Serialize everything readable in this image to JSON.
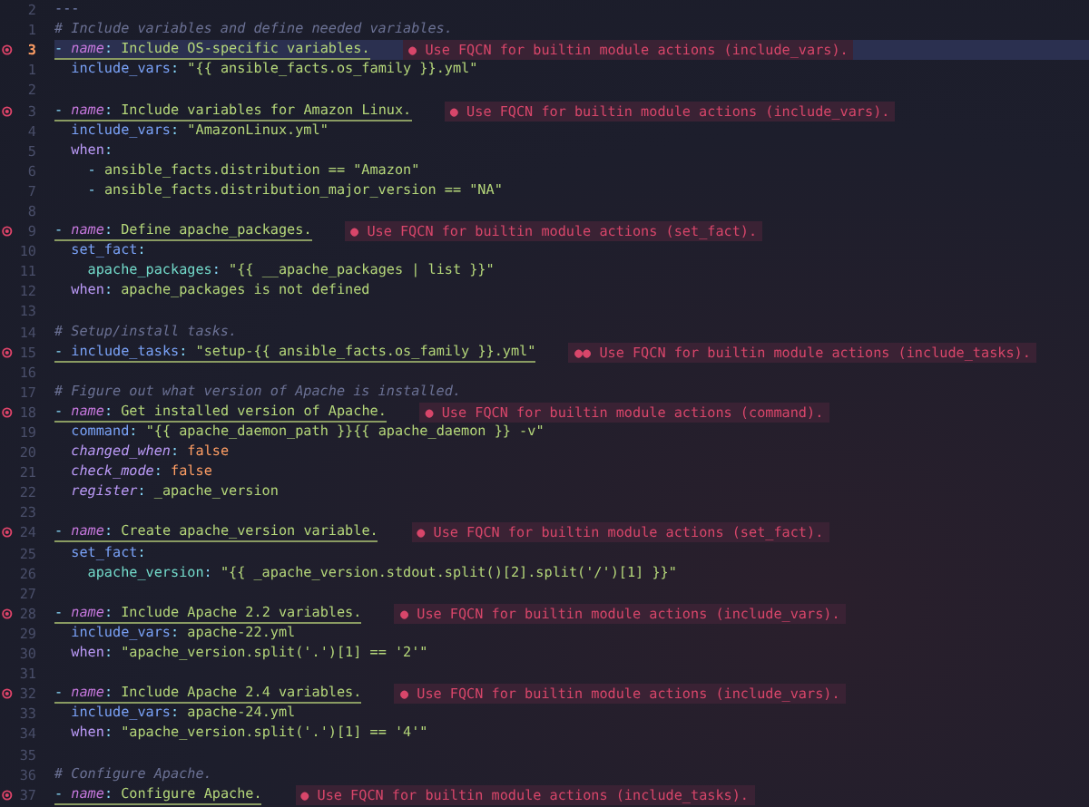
{
  "editor": {
    "lines": [
      {
        "number": "2",
        "error": false,
        "current": false,
        "segments": [
          {
            "kind": "marker",
            "text": "---"
          }
        ]
      },
      {
        "number": "1",
        "error": false,
        "current": false,
        "segments": [
          {
            "kind": "comment",
            "text": "# Include variables and define needed variables."
          }
        ]
      },
      {
        "number": "3",
        "error": true,
        "current": true,
        "segments": [
          {
            "kind": "dash",
            "text": "- "
          },
          {
            "kind": "name",
            "text": "name"
          },
          {
            "kind": "punct",
            "text": ": "
          },
          {
            "kind": "string",
            "text": "Include OS-specific variables."
          }
        ],
        "diagnostic": "● Use FQCN for builtin module actions (include_vars)."
      },
      {
        "number": "1",
        "error": false,
        "current": false,
        "segments": [
          {
            "kind": "key",
            "text": "  include_vars"
          },
          {
            "kind": "punct",
            "text": ": "
          },
          {
            "kind": "string",
            "text": "\"{{ ansible_facts.os_family }}.yml\""
          }
        ]
      },
      {
        "number": "2",
        "error": false,
        "current": false
      },
      {
        "number": "3",
        "error": true,
        "current": false,
        "segments": [
          {
            "kind": "dash",
            "text": "- "
          },
          {
            "kind": "name",
            "text": "name"
          },
          {
            "kind": "punct",
            "text": ": "
          },
          {
            "kind": "string",
            "text": "Include variables for Amazon Linux."
          }
        ],
        "diagnostic": "● Use FQCN for builtin module actions (include_vars)."
      },
      {
        "number": "4",
        "error": false,
        "current": false,
        "segments": [
          {
            "kind": "key",
            "text": "  include_vars"
          },
          {
            "kind": "punct",
            "text": ": "
          },
          {
            "kind": "string",
            "text": "\"AmazonLinux.yml\""
          }
        ]
      },
      {
        "number": "5",
        "error": false,
        "current": false,
        "segments": [
          {
            "kind": "keyword",
            "text": "  when"
          },
          {
            "kind": "punct",
            "text": ":"
          }
        ]
      },
      {
        "number": "6",
        "error": false,
        "current": false,
        "segments": [
          {
            "kind": "punct",
            "text": "    - "
          },
          {
            "kind": "string",
            "text": "ansible_facts.distribution == \"Amazon\""
          }
        ]
      },
      {
        "number": "7",
        "error": false,
        "current": false,
        "segments": [
          {
            "kind": "punct",
            "text": "    - "
          },
          {
            "kind": "string",
            "text": "ansible_facts.distribution_major_version == \"NA\""
          }
        ]
      },
      {
        "number": "8",
        "error": false,
        "current": false
      },
      {
        "number": "9",
        "error": true,
        "current": false,
        "segments": [
          {
            "kind": "dash",
            "text": "- "
          },
          {
            "kind": "name",
            "text": "name"
          },
          {
            "kind": "punct",
            "text": ": "
          },
          {
            "kind": "string",
            "text": "Define apache_packages."
          }
        ],
        "diagnostic": "● Use FQCN for builtin module actions (set_fact)."
      },
      {
        "number": "10",
        "error": false,
        "current": false,
        "segments": [
          {
            "kind": "key",
            "text": "  set_fact"
          },
          {
            "kind": "punct",
            "text": ":"
          }
        ]
      },
      {
        "number": "11",
        "error": false,
        "current": false,
        "segments": [
          {
            "kind": "subkey",
            "text": "    apache_packages"
          },
          {
            "kind": "punct",
            "text": ": "
          },
          {
            "kind": "string",
            "text": "\"{{ __apache_packages | list }}\""
          }
        ]
      },
      {
        "number": "12",
        "error": false,
        "current": false,
        "segments": [
          {
            "kind": "keyword",
            "text": "  when"
          },
          {
            "kind": "punct",
            "text": ": "
          },
          {
            "kind": "string",
            "text": "apache_packages is not defined"
          }
        ]
      },
      {
        "number": "13",
        "error": false,
        "current": false
      },
      {
        "number": "14",
        "error": false,
        "current": false,
        "segments": [
          {
            "kind": "comment",
            "text": "# Setup/install tasks."
          }
        ]
      },
      {
        "number": "15",
        "error": true,
        "current": false,
        "segments": [
          {
            "kind": "dash",
            "text": "- "
          },
          {
            "kind": "key",
            "text": "include_tasks"
          },
          {
            "kind": "punct",
            "text": ": "
          },
          {
            "kind": "string",
            "text": "\"setup-{{ ansible_facts.os_family }}.yml\""
          }
        ],
        "diagnostic": "●● Use FQCN for builtin module actions (include_tasks)."
      },
      {
        "number": "16",
        "error": false,
        "current": false
      },
      {
        "number": "17",
        "error": false,
        "current": false,
        "segments": [
          {
            "kind": "comment",
            "text": "# Figure out what version of Apache is installed."
          }
        ]
      },
      {
        "number": "18",
        "error": true,
        "current": false,
        "segments": [
          {
            "kind": "dash",
            "text": "- "
          },
          {
            "kind": "name",
            "text": "name"
          },
          {
            "kind": "punct",
            "text": ": "
          },
          {
            "kind": "string",
            "text": "Get installed version of Apache."
          }
        ],
        "diagnostic": "● Use FQCN for builtin module actions (command)."
      },
      {
        "number": "19",
        "error": false,
        "current": false,
        "segments": [
          {
            "kind": "key",
            "text": "  command"
          },
          {
            "kind": "punct",
            "text": ": "
          },
          {
            "kind": "string",
            "text": "\"{{ apache_daemon_path }}{{ apache_daemon }} -v\""
          }
        ]
      },
      {
        "number": "20",
        "error": false,
        "current": false,
        "segments": [
          {
            "kind": "italic",
            "text": "  changed_when"
          },
          {
            "kind": "punct",
            "text": ": "
          },
          {
            "kind": "bool",
            "text": "false"
          }
        ]
      },
      {
        "number": "21",
        "error": false,
        "current": false,
        "segments": [
          {
            "kind": "italic",
            "text": "  check_mode"
          },
          {
            "kind": "punct",
            "text": ": "
          },
          {
            "kind": "bool",
            "text": "false"
          }
        ]
      },
      {
        "number": "22",
        "error": false,
        "current": false,
        "segments": [
          {
            "kind": "italic",
            "text": "  register"
          },
          {
            "kind": "punct",
            "text": ": "
          },
          {
            "kind": "string",
            "text": "_apache_version"
          }
        ]
      },
      {
        "number": "23",
        "error": false,
        "current": false
      },
      {
        "number": "24",
        "error": true,
        "current": false,
        "segments": [
          {
            "kind": "dash",
            "text": "- "
          },
          {
            "kind": "name",
            "text": "name"
          },
          {
            "kind": "punct",
            "text": ": "
          },
          {
            "kind": "string",
            "text": "Create apache_version variable."
          }
        ],
        "diagnostic": "● Use FQCN for builtin module actions (set_fact)."
      },
      {
        "number": "25",
        "error": false,
        "current": false,
        "segments": [
          {
            "kind": "key",
            "text": "  set_fact"
          },
          {
            "kind": "punct",
            "text": ":"
          }
        ]
      },
      {
        "number": "26",
        "error": false,
        "current": false,
        "segments": [
          {
            "kind": "subkey",
            "text": "    apache_version"
          },
          {
            "kind": "punct",
            "text": ": "
          },
          {
            "kind": "string",
            "text": "\"{{ _apache_version.stdout.split()[2].split('/')[1] }}\""
          }
        ]
      },
      {
        "number": "27",
        "error": false,
        "current": false
      },
      {
        "number": "28",
        "error": true,
        "current": false,
        "segments": [
          {
            "kind": "dash",
            "text": "- "
          },
          {
            "kind": "name",
            "text": "name"
          },
          {
            "kind": "punct",
            "text": ": "
          },
          {
            "kind": "string",
            "text": "Include Apache 2.2 variables."
          }
        ],
        "diagnostic": "● Use FQCN for builtin module actions (include_vars)."
      },
      {
        "number": "29",
        "error": false,
        "current": false,
        "segments": [
          {
            "kind": "key",
            "text": "  include_vars"
          },
          {
            "kind": "punct",
            "text": ": "
          },
          {
            "kind": "string",
            "text": "apache-22.yml"
          }
        ]
      },
      {
        "number": "30",
        "error": false,
        "current": false,
        "segments": [
          {
            "kind": "keyword",
            "text": "  when"
          },
          {
            "kind": "punct",
            "text": ": "
          },
          {
            "kind": "string",
            "text": "\"apache_version.split('.')[1] == '2'\""
          }
        ]
      },
      {
        "number": "31",
        "error": false,
        "current": false
      },
      {
        "number": "32",
        "error": true,
        "current": false,
        "segments": [
          {
            "kind": "dash",
            "text": "- "
          },
          {
            "kind": "name",
            "text": "name"
          },
          {
            "kind": "punct",
            "text": ": "
          },
          {
            "kind": "string",
            "text": "Include Apache 2.4 variables."
          }
        ],
        "diagnostic": "● Use FQCN for builtin module actions (include_vars)."
      },
      {
        "number": "33",
        "error": false,
        "current": false,
        "segments": [
          {
            "kind": "key",
            "text": "  include_vars"
          },
          {
            "kind": "punct",
            "text": ": "
          },
          {
            "kind": "string",
            "text": "apache-24.yml"
          }
        ]
      },
      {
        "number": "34",
        "error": false,
        "current": false,
        "segments": [
          {
            "kind": "keyword",
            "text": "  when"
          },
          {
            "kind": "punct",
            "text": ": "
          },
          {
            "kind": "string",
            "text": "\"apache_version.split('.')[1] == '4'\""
          }
        ]
      },
      {
        "number": "35",
        "error": false,
        "current": false
      },
      {
        "number": "36",
        "error": false,
        "current": false,
        "segments": [
          {
            "kind": "comment",
            "text": "# Configure Apache."
          }
        ]
      },
      {
        "number": "37",
        "error": true,
        "current": false,
        "segments": [
          {
            "kind": "dash",
            "text": "- "
          },
          {
            "kind": "name",
            "text": "name"
          },
          {
            "kind": "punct",
            "text": ": "
          },
          {
            "kind": "string",
            "text": "Configure Apache."
          }
        ],
        "diagnostic": "● Use FQCN for builtin module actions (include_tasks)."
      }
    ]
  }
}
